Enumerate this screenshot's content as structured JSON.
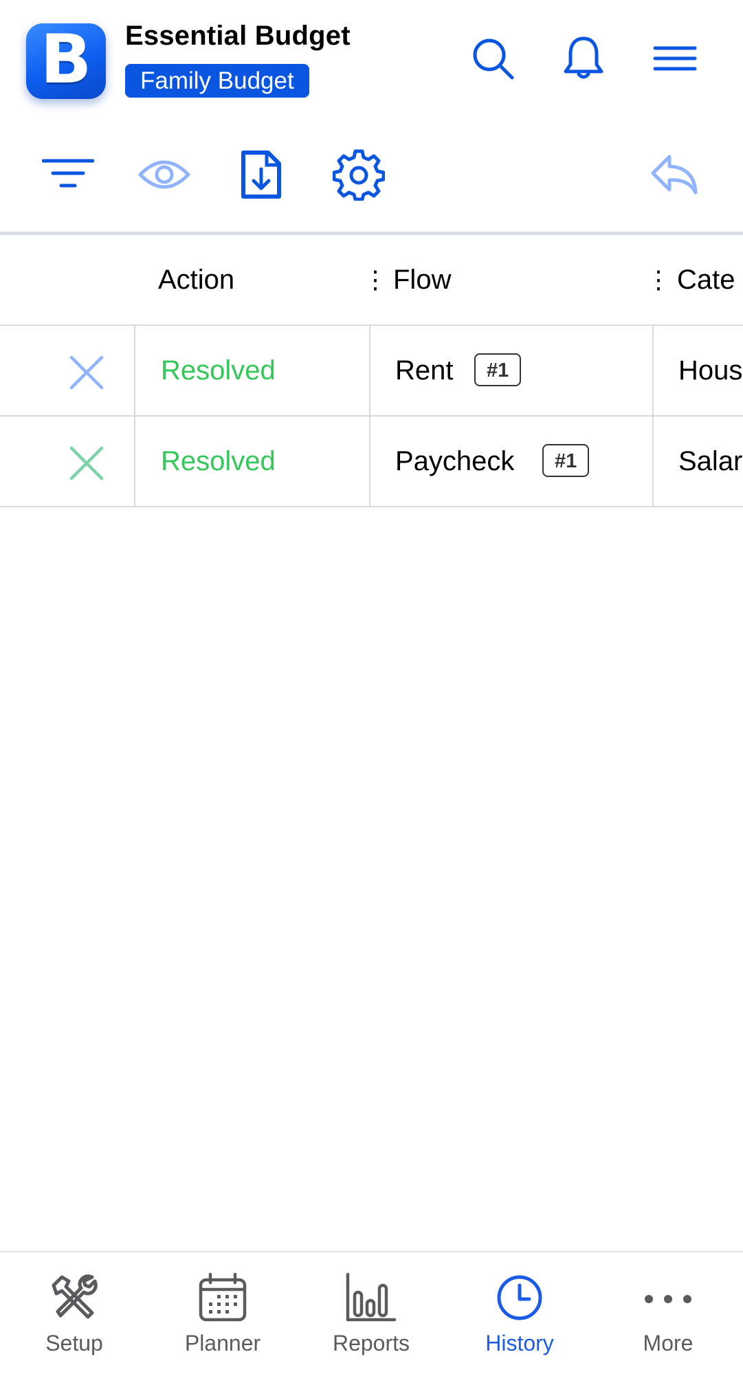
{
  "header": {
    "logo_letter": "B",
    "app_title": "Essential Budget",
    "budget_name": "Family Budget",
    "icons": [
      "search-icon",
      "bell-icon",
      "hamburger-menu-icon"
    ]
  },
  "toolbar": {
    "icons": [
      "filter-icon",
      "eye-icon",
      "download-file-icon",
      "gear-icon",
      "undo-icon"
    ]
  },
  "table": {
    "columns": [
      "Action",
      "Flow",
      "Cate"
    ],
    "rows": [
      {
        "status": "Resolved",
        "flow": "Rent",
        "tag": "#1",
        "category": "Hous",
        "x_color": "#8fb3ff"
      },
      {
        "status": "Resolved",
        "flow": "Paycheck",
        "tag": "#1",
        "category": "Salar",
        "x_color": "#7dd3a8"
      }
    ]
  },
  "nav": {
    "items": [
      {
        "label": "Setup",
        "icon": "tools-icon"
      },
      {
        "label": "Planner",
        "icon": "calendar-icon"
      },
      {
        "label": "Reports",
        "icon": "bar-chart-icon"
      },
      {
        "label": "History",
        "icon": "clock-icon"
      },
      {
        "label": "More",
        "icon": "more-dots-icon"
      }
    ],
    "active": "History"
  },
  "colors": {
    "accent": "#0b56e0",
    "resolved": "#34c759",
    "nav_inactive": "#5a5a5f"
  }
}
